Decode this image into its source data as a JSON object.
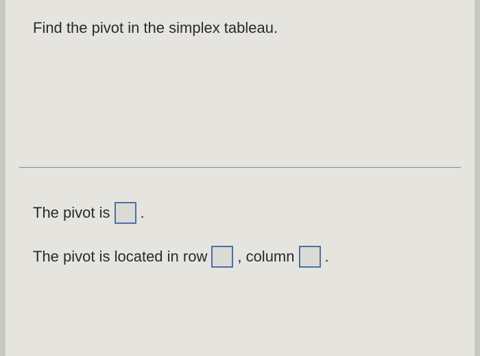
{
  "question": {
    "prompt": "Find the pivot in the simplex tableau."
  },
  "answers": {
    "line1": {
      "prefix": "The pivot is",
      "suffix": "."
    },
    "line2": {
      "prefix": "The pivot is located in row",
      "mid": ", column",
      "suffix": "."
    }
  }
}
